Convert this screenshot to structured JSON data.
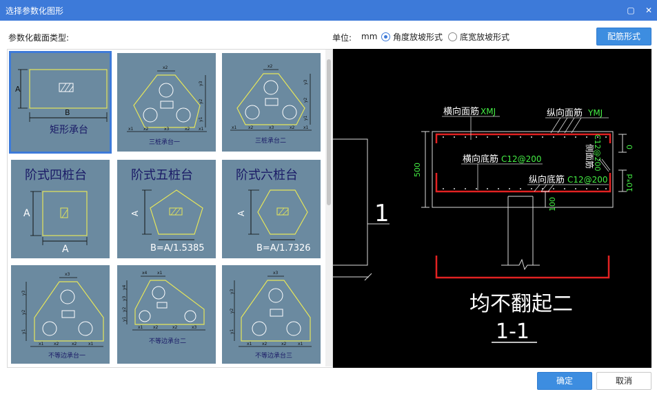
{
  "window": {
    "title": "选择参数化图形",
    "restore_glyph": "▢",
    "close_glyph": "✕"
  },
  "toolbar": {
    "section_label": "参数化截面类型:",
    "unit_label": "单位:",
    "unit_value": "mm",
    "radio_angle": "角度放坡形式",
    "radio_width": "底宽放坡形式",
    "rebar_button": "配筋形式"
  },
  "tiles": [
    {
      "name": "矩形承台",
      "dim_a": "A",
      "dim_b": "B"
    },
    {
      "name": "三桩承台一",
      "dims": [
        "x1",
        "x2",
        "x3",
        "x2",
        "x1",
        "y1",
        "y2",
        "y3"
      ]
    },
    {
      "name": "三桩承台二",
      "dims": [
        "x1",
        "x2",
        "x3",
        "x2",
        "x1",
        "y1",
        "y2",
        "y3"
      ]
    },
    {
      "name": "阶式四桩台",
      "dim_a": "A",
      "dim_b": "A"
    },
    {
      "name": "阶式五桩台",
      "dim_a": "A",
      "formula": "B=A/1.5385"
    },
    {
      "name": "阶式六桩台",
      "dim_a": "A",
      "formula": "B=A/1.7326"
    },
    {
      "name": "不等边承台一",
      "dims": [
        "x3",
        "x1",
        "x2",
        "x2",
        "x1",
        "y1",
        "y2",
        "y3"
      ]
    },
    {
      "name": "不等边承台二",
      "dims": [
        "x4",
        "x1",
        "x2",
        "x2",
        "x3",
        "y1",
        "y2",
        "y3",
        "y4"
      ]
    },
    {
      "name": "不等边承台三",
      "dims": [
        "x3",
        "x1",
        "x2",
        "x2",
        "x1",
        "y1",
        "y2",
        "y3"
      ]
    }
  ],
  "preview": {
    "label_top_transverse": "横向面筋",
    "code_top_transverse": "XMJ",
    "label_top_longitudinal": "纵向面筋",
    "code_top_longitudinal": "YMJ",
    "label_bottom_transverse": "横向底筋",
    "code_bottom_transverse": "C12@200",
    "label_bottom_longitudinal": "纵向底筋",
    "code_bottom_longitudinal": "C12@200",
    "label_side": "侧面筋",
    "code_side": "C12@200",
    "dim_height": "500",
    "dim_cover_top": "0",
    "dim_cover_bottom": "10*d",
    "dim_embed": "100",
    "section_mark": "1",
    "caption": "均不翻起二",
    "section_title": "1-1"
  },
  "footer": {
    "ok": "确定",
    "cancel": "取消"
  },
  "colors": {
    "accent": "#3d7ad9",
    "tile_bg": "#6b8aa0",
    "shape_line": "#e6e65a",
    "rebar_red": "#e32222",
    "cad_green": "#44ee44"
  }
}
